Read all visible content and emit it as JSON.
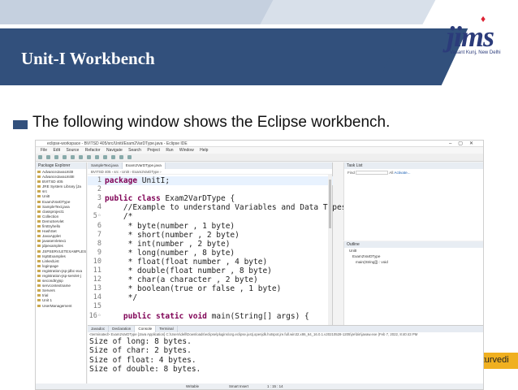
{
  "slide": {
    "title": "Unit-I Workbench",
    "bullet": "The following window shows the Eclipse workbench.",
    "footer_author": "Arpana Chaturvedi",
    "logo_text": "jims",
    "logo_sub": "Vasant Kunj, New Delhi"
  },
  "colors": {
    "band": "#32507c",
    "footer": "#f0b020",
    "keyword": "#7f0055",
    "comment": "#3f7f5f"
  },
  "eclipse": {
    "window_title": "eclipse-workspace - BVITSD 405/src/UnitI/Exam2VarDType.java - Eclipse IDE",
    "menu": [
      "File",
      "Edit",
      "Source",
      "Refactor",
      "Navigate",
      "Search",
      "Project",
      "Run",
      "Window",
      "Help"
    ],
    "package_explorer": {
      "header": "Package Explorer",
      "items": [
        "AdvanceJavaUnitII",
        "AdvanceJavaUnitIII",
        "BVITSD 405",
        "JRE System Library [Ja",
        "src",
        "UnitI",
        "Exam2VarDType",
        "SampleText.java",
        "classproject1",
        "Collection",
        "DemoServlet",
        "firsttryhello",
        "HashSet",
        "JavaApplet",
        "javaservletex1",
        "jdpexamples",
        "JSPSERVLETEXAMPLES",
        "Isp5Examples",
        "LinkedList",
        "loginpage",
        "registration-jsp-jdbc-exa",
        "registration-jsp-servlet-j",
        "secondtryjsp",
        "servcontextname",
        "Servers",
        "trial",
        "Unit 1",
        "UserManagement"
      ]
    },
    "editor": {
      "tabs": [
        "SampleText.java",
        "Exam2VarDType.java"
      ],
      "breadcrumb": "BVITSD 405 › src › UnitI › Exam2VarDType ›",
      "lines": [
        {
          "n": "1",
          "text": "package UnitI;"
        },
        {
          "n": "2",
          "text": ""
        },
        {
          "n": "3",
          "text": "public class Exam2VarDType {"
        },
        {
          "n": "4",
          "text": "    //Example to understand Variables and Data Types"
        },
        {
          "n": "5◦",
          "text": "    /*"
        },
        {
          "n": "6",
          "text": "     * byte(number , 1 byte)"
        },
        {
          "n": "7",
          "text": "     * short(number , 2 byte)"
        },
        {
          "n": "8",
          "text": "     * int(number , 2 byte)"
        },
        {
          "n": "9",
          "text": "     * long(number , 8 byte)"
        },
        {
          "n": "10",
          "text": "     * float(float number , 4 byte)"
        },
        {
          "n": "11",
          "text": "     * double(float number , 8 byte)"
        },
        {
          "n": "12",
          "text": "     * char(a character , 2 byte)"
        },
        {
          "n": "13",
          "text": "     * boolean(true or false , 1 byte)"
        },
        {
          "n": "14",
          "text": "     */"
        },
        {
          "n": "15",
          "text": ""
        },
        {
          "n": "16◦",
          "text": "    public static void main(String[] args) {"
        }
      ]
    },
    "task_list": {
      "header": "Task List",
      "find": "Find",
      "all": "All",
      "activate": "Activate..."
    },
    "outline": {
      "header": "Outline",
      "items": [
        "UnitI",
        "Exam2VarDType",
        "main(String[]) : void"
      ]
    },
    "console": {
      "tabs": [
        "Javadoc",
        "Declaration",
        "Console",
        "Terminal"
      ],
      "terminated": "<terminated> Exam2VarDType [Java Application] C:\\Users\\dell\\Downloads\\eclipse\\plugins\\org.eclipse.justj.openjdk.hotspot.jre.full.win32.x86_64_16.0.1.v20210528-1205\\jre\\bin\\javaw.exe (Feb 7, 2022, 8:40:43 PM",
      "output": [
        "Size of long: 8 bytes.",
        "Size of char: 2 bytes.",
        "Size of float: 4 bytes.",
        "Size of double: 8 bytes."
      ]
    },
    "status": {
      "writable": "Writable",
      "insert": "Smart Insert",
      "position": "1 : 15 : 14"
    }
  }
}
